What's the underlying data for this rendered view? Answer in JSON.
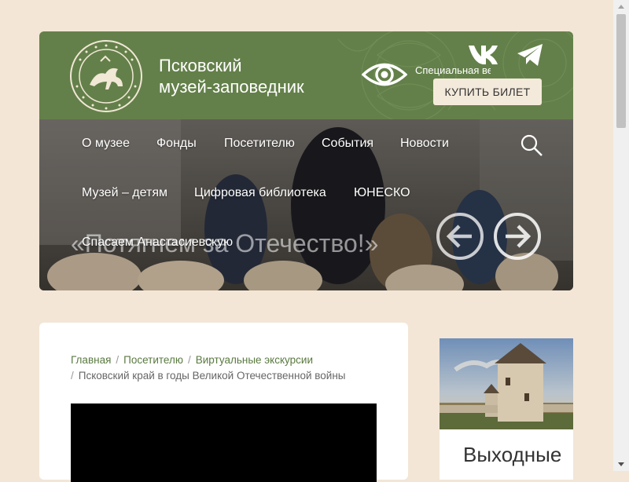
{
  "header": {
    "title_line1": "Псковский",
    "title_line2": "музей-заповедник",
    "special_version": "Специальная версия",
    "buy_ticket": "КУПИТЬ БИЛЕТ"
  },
  "nav": {
    "items": [
      "О музее",
      "Фонды",
      "Посетителю",
      "События",
      "Новости",
      "Музей – детям",
      "Цифровая библиотека",
      "ЮНЕСКО",
      "Спасаем Анастасиевскую"
    ]
  },
  "slider": {
    "caption": "«Потягнем за Отечество!»"
  },
  "breadcrumb": {
    "items": [
      "Главная",
      "Посетителю",
      "Виртуальные экскурсии"
    ],
    "current": "Псковский край в годы Великой Отечественной войны"
  },
  "sidebar": {
    "card_title": "Выходные"
  },
  "icons": {
    "logo": "museum-seal-logo",
    "eye": "eye-icon",
    "vk": "vk-icon",
    "telegram": "telegram-icon",
    "search": "search-icon",
    "prev": "arrow-left-icon",
    "next": "arrow-right-icon"
  },
  "colors": {
    "page_bg": "#f3e6d6",
    "header_green": "#64804a",
    "button_bg": "#f4eadb",
    "link_green": "#5a7a40"
  }
}
